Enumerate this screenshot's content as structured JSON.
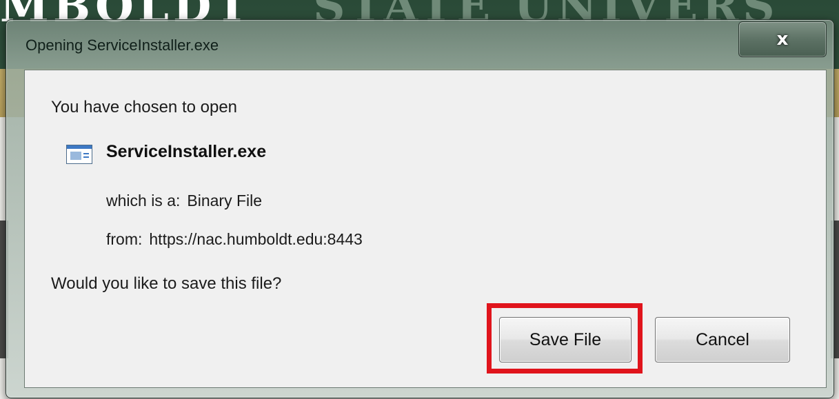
{
  "background": {
    "banner_left": "MBOLDT",
    "banner_right": "STATE UNIVERS"
  },
  "dialog": {
    "title": "Opening ServiceInstaller.exe",
    "close_label": "x",
    "prompt": "You have chosen to open",
    "file_name": "ServiceInstaller.exe",
    "type_label": "which is a:",
    "type_value": "Binary File",
    "source_label": "from:",
    "source_value": "https://nac.humboldt.edu:8443",
    "question": "Would you like to save this file?",
    "buttons": {
      "save": "Save File",
      "cancel": "Cancel"
    }
  },
  "colors": {
    "highlight": "#e0141c",
    "banner_green": "#2a4a37",
    "banner_gold": "#c7b06a"
  },
  "icons": {
    "file": "application-window-icon"
  }
}
